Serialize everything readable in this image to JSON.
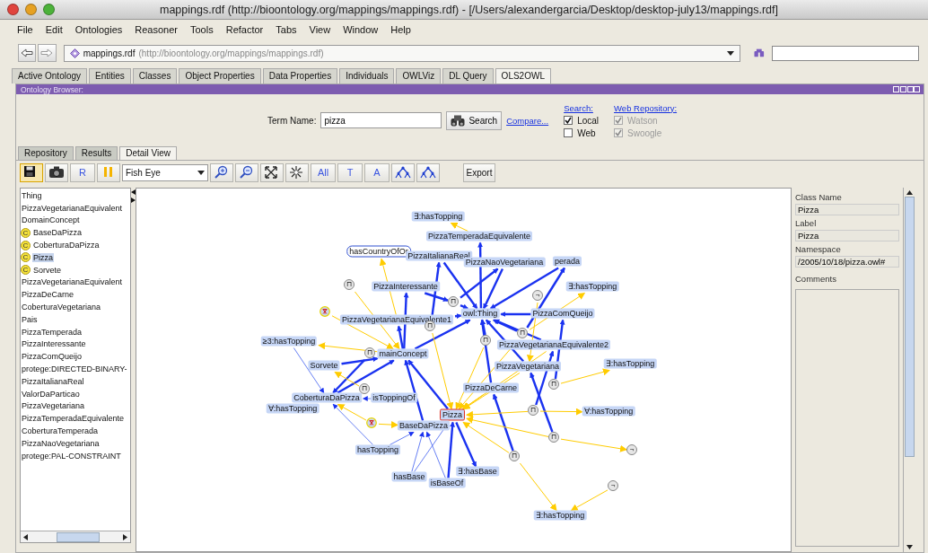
{
  "window": {
    "title": "mappings.rdf (http://bioontology.org/mappings/mappings.rdf) - [/Users/alexandergarcia/Desktop/desktop-july13/mappings.rdf]"
  },
  "menu": [
    "File",
    "Edit",
    "Ontologies",
    "Reasoner",
    "Tools",
    "Refactor",
    "Tabs",
    "View",
    "Window",
    "Help"
  ],
  "address": {
    "name": "mappings.rdf",
    "url": "(http://bioontology.org/mappings/mappings.rdf)"
  },
  "tabs": [
    {
      "label": "Active Ontology",
      "selected": false
    },
    {
      "label": "Entities",
      "selected": false
    },
    {
      "label": "Classes",
      "selected": false
    },
    {
      "label": "Object Properties",
      "selected": false
    },
    {
      "label": "Data Properties",
      "selected": false
    },
    {
      "label": "Individuals",
      "selected": false
    },
    {
      "label": "OWLViz",
      "selected": false
    },
    {
      "label": "DL Query",
      "selected": false
    },
    {
      "label": "OLS2OWL",
      "selected": true
    }
  ],
  "panel": {
    "title": "Ontology Browser:"
  },
  "search": {
    "term_label": "Term Name:",
    "term": "pizza",
    "button": "Search",
    "compare_link": "Compare...",
    "groups": [
      {
        "heading": "Search:",
        "options": [
          {
            "label": "Local",
            "checked": true,
            "disabled": false
          },
          {
            "label": "Web",
            "checked": false,
            "disabled": false
          }
        ]
      },
      {
        "heading": "Web Repository:",
        "options": [
          {
            "label": "Watson",
            "checked": true,
            "disabled": true
          },
          {
            "label": "Swoogle",
            "checked": true,
            "disabled": true
          }
        ]
      }
    ]
  },
  "subtabs": [
    {
      "label": "Repository",
      "selected": false
    },
    {
      "label": "Results",
      "selected": false
    },
    {
      "label": "Detail View",
      "selected": true
    }
  ],
  "toolbar": [
    {
      "kind": "save",
      "pressed": true
    },
    {
      "kind": "camera",
      "pressed": false
    },
    {
      "kind": "text",
      "text": "R",
      "pressed": false
    },
    {
      "kind": "pause",
      "pressed": false
    },
    {
      "kind": "select",
      "text": "Fish Eye"
    },
    {
      "kind": "zoom-in",
      "pressed": false
    },
    {
      "kind": "zoom-out",
      "pressed": false
    },
    {
      "kind": "fit",
      "pressed": false
    },
    {
      "kind": "burst",
      "pressed": false
    },
    {
      "kind": "text",
      "text": "All",
      "pressed": false
    },
    {
      "kind": "text",
      "text": "T",
      "pressed": false
    },
    {
      "kind": "text",
      "text": "A",
      "pressed": false
    },
    {
      "kind": "tree",
      "pressed": false
    },
    {
      "kind": "tree",
      "pressed": false
    },
    {
      "kind": "button",
      "text": "Export"
    }
  ],
  "class_list": [
    {
      "text": "Thing",
      "kind": "plain",
      "selected": false
    },
    {
      "text": "PizzaVegetarianaEquivalent",
      "kind": "plain",
      "selected": false
    },
    {
      "text": "DomainConcept",
      "kind": "plain",
      "selected": false
    },
    {
      "text": "BaseDaPizza",
      "kind": "class",
      "badge": "C",
      "selected": false
    },
    {
      "text": "CoberturaDaPizza",
      "kind": "class",
      "badge": "C",
      "selected": false
    },
    {
      "text": "Pizza",
      "kind": "class",
      "badge": "C",
      "selected": true
    },
    {
      "text": "Sorvete",
      "kind": "class",
      "badge": "C",
      "selected": false
    },
    {
      "text": "PizzaVegetarianaEquivalent",
      "kind": "plain",
      "selected": false
    },
    {
      "text": "PizzaDeCarne",
      "kind": "plain",
      "selected": false
    },
    {
      "text": "CoberturaVegetariana",
      "kind": "plain",
      "selected": false
    },
    {
      "text": "Pais",
      "kind": "plain",
      "selected": false
    },
    {
      "text": "PizzaTemperada",
      "kind": "plain",
      "selected": false
    },
    {
      "text": "PizzaInteressante",
      "kind": "plain",
      "selected": false
    },
    {
      "text": "PizzaComQueijo",
      "kind": "plain",
      "selected": false
    },
    {
      "text": "protege:DIRECTED-BINARY-",
      "kind": "plain",
      "selected": false
    },
    {
      "text": "PizzaItalianaReal",
      "kind": "plain",
      "selected": false
    },
    {
      "text": "ValorDaParticao",
      "kind": "plain",
      "selected": false
    },
    {
      "text": "PizzaVegetariana",
      "kind": "plain",
      "selected": false
    },
    {
      "text": "PizzaTemperadaEquivalente",
      "kind": "plain",
      "selected": false
    },
    {
      "text": "CoberturaTemperada",
      "kind": "plain",
      "selected": false
    },
    {
      "text": "PizzaNaoVegetariana",
      "kind": "plain",
      "selected": false
    },
    {
      "text": "protege:PAL-CONSTRAINT",
      "kind": "plain",
      "selected": false
    }
  ],
  "graph": {
    "nodes": [
      {
        "label": "∃:hasTopping",
        "kind": "class",
        "selected": false
      },
      {
        "label": "PizzaTemperadaEquivalente",
        "kind": "class",
        "selected": false
      },
      {
        "label": "hasCountryOfOr",
        "kind": "property",
        "selected": false
      },
      {
        "label": "PizzaItalianaReal",
        "kind": "class",
        "selected": false
      },
      {
        "label": "PizzaNaoVegetariana",
        "kind": "class",
        "selected": false
      },
      {
        "label": "perada",
        "kind": "class",
        "selected": false
      },
      {
        "label": "PizzaInteressante",
        "kind": "class",
        "selected": false
      },
      {
        "label": "∃:hasTopping",
        "kind": "class",
        "selected": false
      },
      {
        "label": "owl:Thing",
        "kind": "class",
        "selected": false
      },
      {
        "label": "PizzaComQueijo",
        "kind": "class",
        "selected": false
      },
      {
        "label": "PizzaVegetarianaEquivalente1",
        "kind": "class",
        "selected": false
      },
      {
        "label": "≥3:hasTopping",
        "kind": "class",
        "selected": false
      },
      {
        "label": "PizzaVegetarianaEquivalente2",
        "kind": "class",
        "selected": false
      },
      {
        "label": "mainConcept",
        "kind": "class",
        "selected": false
      },
      {
        "label": "Sorvete",
        "kind": "class",
        "selected": false
      },
      {
        "label": "PizzaVegetariana",
        "kind": "class",
        "selected": false
      },
      {
        "label": "∃:hasTopping",
        "kind": "class",
        "selected": false
      },
      {
        "label": "PizzaDeCarne",
        "kind": "class",
        "selected": false
      },
      {
        "label": "CoberturaDaPizza",
        "kind": "class",
        "selected": false
      },
      {
        "label": "isToppingOf",
        "kind": "class",
        "selected": false
      },
      {
        "label": "∀:hasTopping",
        "kind": "class",
        "selected": false
      },
      {
        "label": "Pizza",
        "kind": "class",
        "selected": true
      },
      {
        "label": "∀:hasTopping",
        "kind": "class",
        "selected": false
      },
      {
        "label": "BaseDaPizza",
        "kind": "class",
        "selected": false
      },
      {
        "label": "hasTopping",
        "kind": "class",
        "selected": false
      },
      {
        "label": "hasBase",
        "kind": "class",
        "selected": false
      },
      {
        "label": "∃:hasBase",
        "kind": "class",
        "selected": false
      },
      {
        "label": "isBaseOf",
        "kind": "class",
        "selected": false
      },
      {
        "label": "∃:hasTopping",
        "kind": "class",
        "selected": false
      },
      {
        "label": "⊓",
        "kind": "operator",
        "selected": false
      },
      {
        "label": "¬",
        "kind": "operator",
        "selected": false
      },
      {
        "label": "⊓",
        "kind": "operator",
        "selected": false
      },
      {
        "kind": "restriction",
        "selected": false
      },
      {
        "label": "⊓",
        "kind": "operator",
        "selected": false
      },
      {
        "label": "⊓",
        "kind": "operator",
        "selected": false
      },
      {
        "label": "⊓",
        "kind": "operator",
        "selected": false
      },
      {
        "label": "⊓",
        "kind": "operator",
        "selected": false
      },
      {
        "label": "⊓",
        "kind": "operator",
        "selected": false
      },
      {
        "label": "⊓",
        "kind": "operator",
        "selected": false
      },
      {
        "kind": "restriction",
        "selected": false
      },
      {
        "label": "⊓",
        "kind": "operator",
        "selected": false
      },
      {
        "label": "⊓",
        "kind": "operator",
        "selected": false
      },
      {
        "label": "¬",
        "kind": "operator",
        "selected": false
      },
      {
        "label": "⊓",
        "kind": "operator",
        "selected": false
      },
      {
        "label": "¬",
        "kind": "operator",
        "selected": false
      }
    ]
  },
  "details": {
    "fields": [
      {
        "label": "Class Name",
        "value": "Pizza"
      },
      {
        "label": "Label",
        "value": "Pizza"
      },
      {
        "label": "Namespace",
        "value": "/2005/10/18/pizza.owl#"
      }
    ],
    "comments_label": "Comments"
  }
}
